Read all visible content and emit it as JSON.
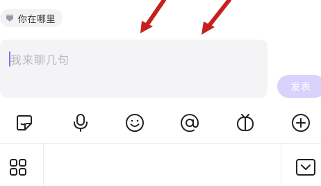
{
  "location_chip": {
    "label": "你在哪里",
    "icon": "location-pin-icon"
  },
  "composer": {
    "placeholder": "我来聊几句",
    "send_label": "发表"
  },
  "toolbar": {
    "icons": [
      "sticker-icon",
      "microphone-icon",
      "emoji-icon",
      "mention-icon",
      "tv-icon",
      "add-icon"
    ]
  },
  "bottom_bar": {
    "icons": [
      "apps-grid-icon",
      "collapse-keyboard-icon"
    ]
  },
  "colors": {
    "accent": "#7b6cf6",
    "send_button_disabled": "#d9d2fc",
    "arrow": "#c8201e"
  }
}
